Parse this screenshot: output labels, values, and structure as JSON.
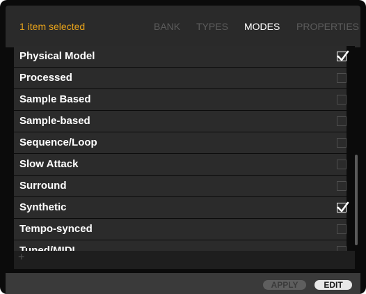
{
  "header": {
    "selection_status": "1 item selected",
    "tabs": [
      {
        "label": "BANK",
        "active": false
      },
      {
        "label": "TYPES",
        "active": false
      },
      {
        "label": "MODES",
        "active": true
      },
      {
        "label": "PROPERTIES",
        "active": false
      }
    ]
  },
  "modes": [
    {
      "label": "Physical Model",
      "checked": true
    },
    {
      "label": "Processed",
      "checked": false
    },
    {
      "label": "Sample Based",
      "checked": false
    },
    {
      "label": "Sample-based",
      "checked": false
    },
    {
      "label": "Sequence/Loop",
      "checked": false
    },
    {
      "label": "Slow Attack",
      "checked": false
    },
    {
      "label": "Surround",
      "checked": false
    },
    {
      "label": "Synthetic",
      "checked": true
    },
    {
      "label": "Tempo-synced",
      "checked": false
    },
    {
      "label": "Tuned/MIDI",
      "checked": false
    }
  ],
  "add_icon": "plus-icon",
  "footer": {
    "apply_label": "APPLY",
    "edit_label": "EDIT"
  },
  "colors": {
    "accent": "#e8a31a",
    "panel": "#2b2b2b",
    "background": "#0b0b0b",
    "tab_inactive": "#5c5c5c",
    "tab_active": "#ffffff"
  }
}
